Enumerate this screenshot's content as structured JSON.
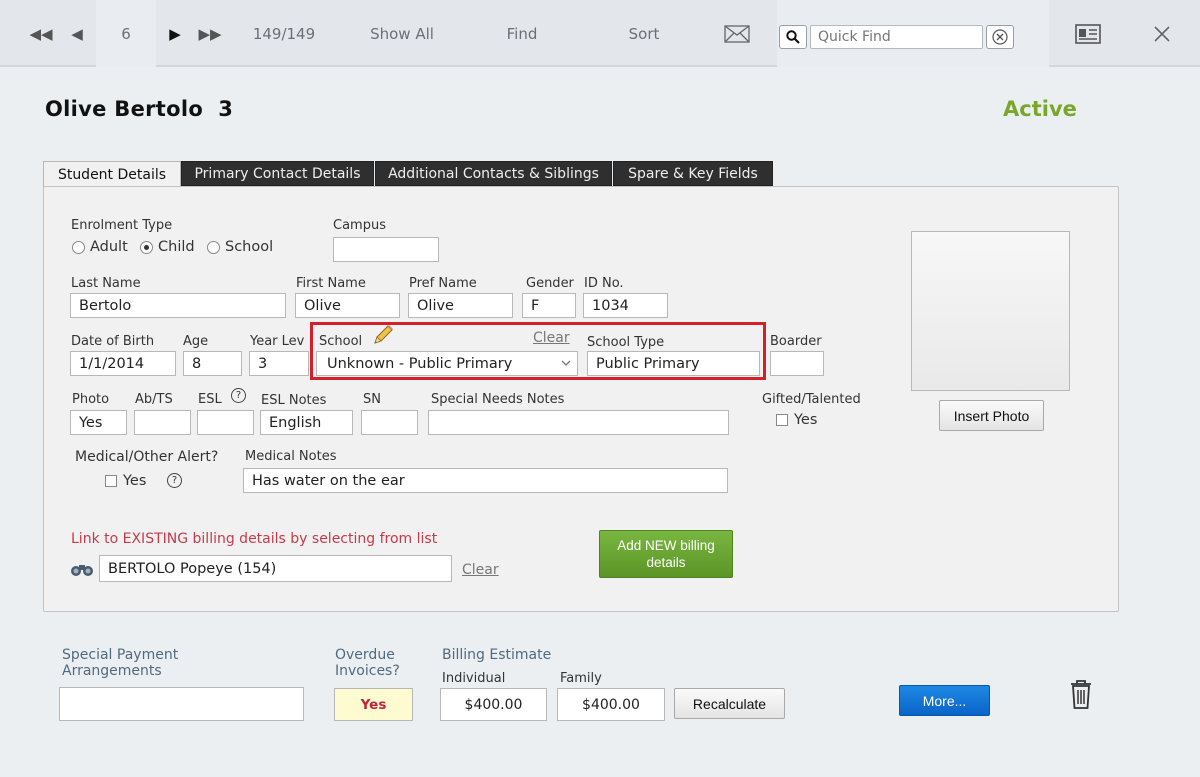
{
  "toolbar": {
    "record_number": "6",
    "record_count": "149/149",
    "show_all": "Show All",
    "find": "Find",
    "sort": "Sort",
    "quick_find_placeholder": "Quick Find"
  },
  "header": {
    "title": "Olive Bertolo  3",
    "status": "Active",
    "status_color": "#7aa62a"
  },
  "tabs": [
    {
      "label": "Student Details",
      "active": true
    },
    {
      "label": "Primary Contact Details",
      "active": false
    },
    {
      "label": "Additional Contacts & Siblings",
      "active": false
    },
    {
      "label": "Spare & Key Fields",
      "active": false
    }
  ],
  "form": {
    "enrolment_type_label": "Enrolment Type",
    "enrolment_options": [
      "Adult",
      "Child",
      "School"
    ],
    "enrolment_selected": "Child",
    "campus_label": "Campus",
    "campus_value": "",
    "last_name_label": "Last Name",
    "last_name": "Bertolo",
    "first_name_label": "First Name",
    "first_name": "Olive",
    "pref_name_label": "Pref Name",
    "pref_name": "Olive",
    "gender_label": "Gender",
    "gender": "F",
    "id_label": "ID No.",
    "id_value": "1034",
    "dob_label": "Date of Birth",
    "dob": "1/1/2014",
    "age_label": "Age",
    "age": "8",
    "year_label": "Year Lev",
    "year": "3",
    "school_label": "School",
    "school_clear": "Clear",
    "school_value": "Unknown - Public Primary",
    "school_type_label": "School Type",
    "school_type": "Public Primary",
    "boarder_label": "Boarder",
    "boarder": "",
    "photo_label": "Photo",
    "photo": "Yes",
    "abts_label": "Ab/TS",
    "esl_label": "ESL",
    "esl_notes_label": "ESL Notes",
    "esl_notes": "English",
    "sn_label": "SN",
    "special_needs_label": "Special Needs Notes",
    "gifted_label": "Gifted/Talented",
    "gifted_yes": "Yes",
    "medical_label": "Medical/Other Alert?",
    "medical_yes": "Yes",
    "medical_notes_label": "Medical Notes",
    "medical_notes": "Has water on the ear",
    "insert_photo": "Insert Photo",
    "link_existing": "Link to EXISTING billing details by selecting from list",
    "billing_contact": "BERTOLO Popeye (154)",
    "billing_clear": "Clear",
    "add_billing_line1": "Add NEW billing",
    "add_billing_line2": "details"
  },
  "footer": {
    "special_payment_line1": "Special Payment",
    "special_payment_line2": "Arrangements",
    "special_payment_value": "",
    "overdue_line1": "Overdue",
    "overdue_line2": "Invoices?",
    "overdue_value": "Yes",
    "billing_estimate": "Billing Estimate",
    "individual_label": "Individual",
    "individual_value": "$400.00",
    "family_label": "Family",
    "family_value": "$400.00",
    "recalculate": "Recalculate",
    "more": "More..."
  }
}
